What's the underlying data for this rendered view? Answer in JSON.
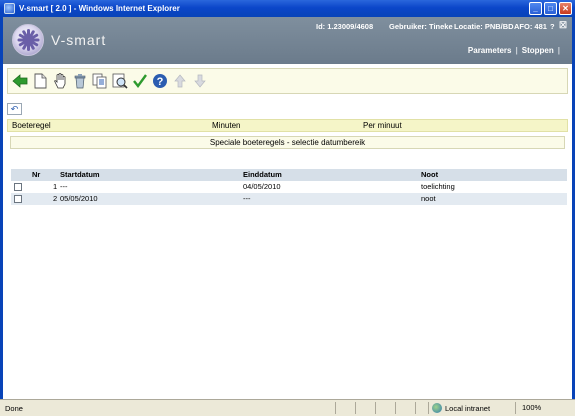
{
  "window": {
    "title": "V-smart [ 2.0 ] - Windows Internet Explorer",
    "buttons": {
      "minimize": "_",
      "maximize": "□",
      "close": "✕"
    }
  },
  "header": {
    "logo_text": "V-smart",
    "id_label": "Id: 1.23009/4608",
    "user_label": "Gebruiker: Tineke",
    "location_label": "Locatie: PNB/BD",
    "afo_label": "AFO: 481",
    "help": "?",
    "close": "☒",
    "parameters": "Parameters",
    "stop": "Stoppen",
    "separator": "|"
  },
  "toolbar": {
    "icons": [
      "back-arrow-icon",
      "new-document-icon",
      "hand-select-icon",
      "delete-icon",
      "copy-icon",
      "preview-icon",
      "checkmark-icon",
      "help-icon",
      "arrow-up-icon",
      "arrow-down-icon"
    ]
  },
  "columns_header": {
    "col1": "Boeteregel",
    "col2": "Minuten",
    "col3": "Per minuut"
  },
  "section_title": "Speciale boeteregels - selectie datumbereik",
  "table": {
    "headers": {
      "nr": "Nr",
      "start": "Startdatum",
      "end": "Einddatum",
      "note": "Noot"
    },
    "rows": [
      {
        "nr": "1",
        "start": "---",
        "end": "04/05/2010",
        "note": "toelichting"
      },
      {
        "nr": "2",
        "start": "05/05/2010",
        "end": "---",
        "note": "noot"
      }
    ]
  },
  "status": {
    "done": "Done",
    "zone": "Local intranet",
    "zoom": "100%"
  },
  "colors": {
    "title_bar": "#0b46c9",
    "header_bg": "#7f8f9e",
    "toolbar_bg": "#fbfbe8",
    "table_header_bg": "#d6dfe8",
    "row_alt_bg": "#e3eaf1"
  }
}
